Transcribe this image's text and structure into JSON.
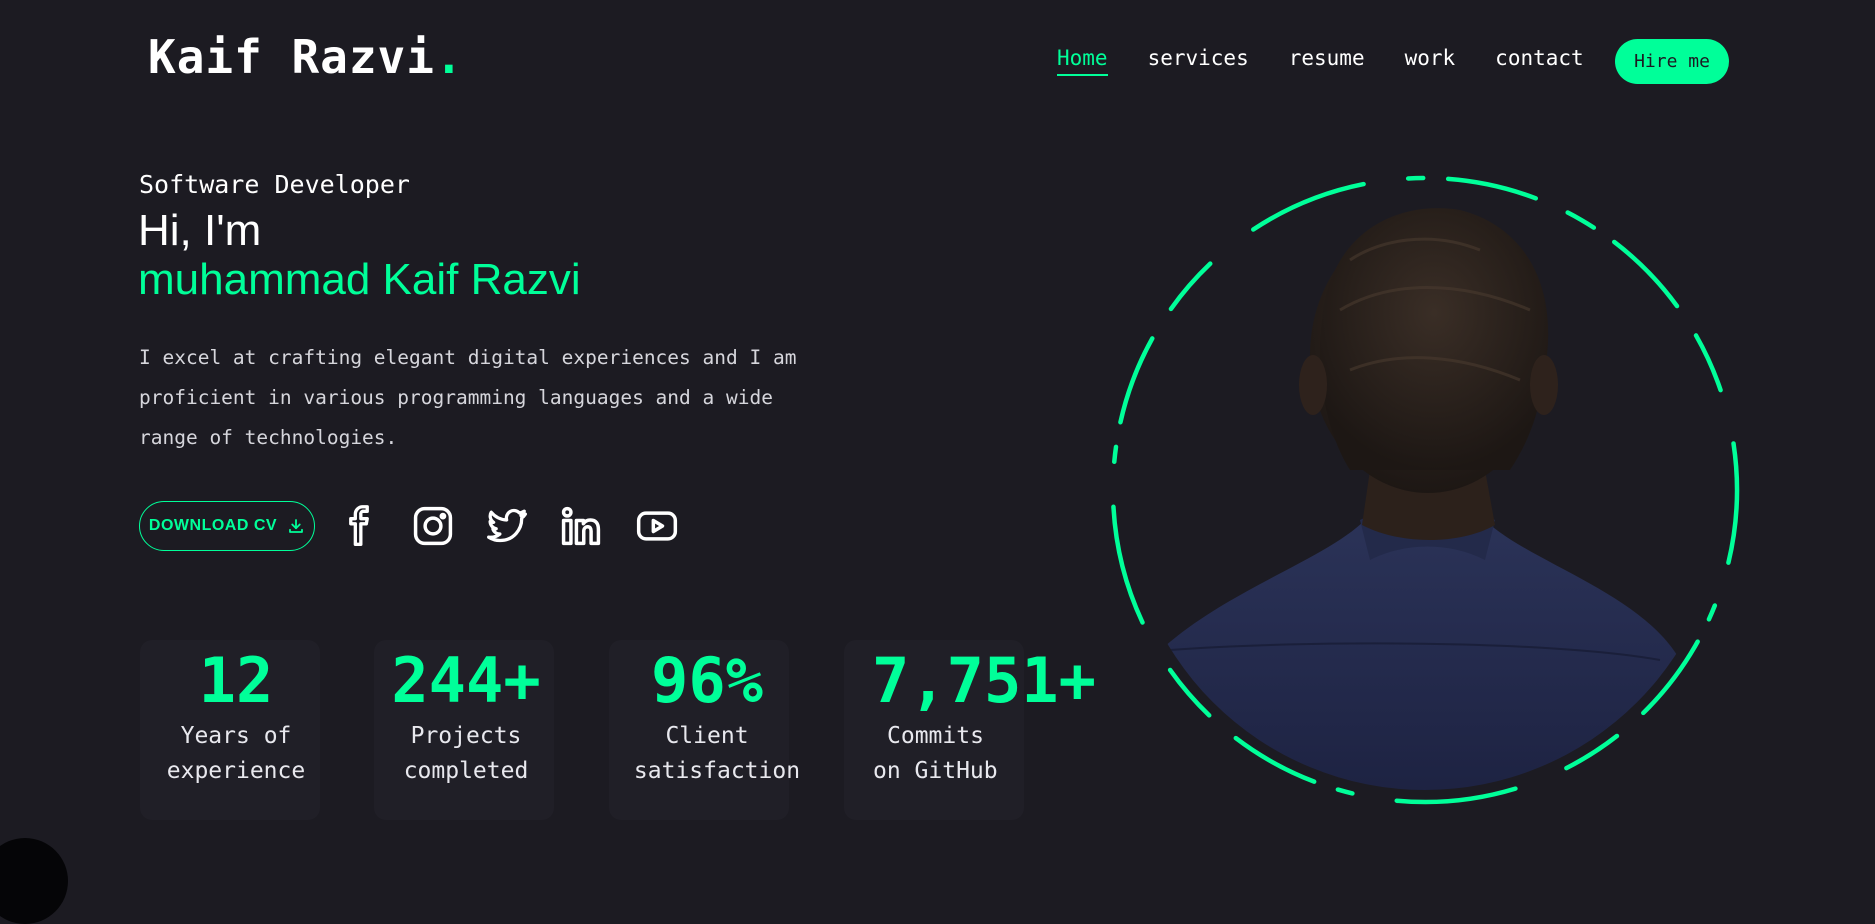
{
  "header": {
    "logo_text": "Kaif Razvi",
    "logo_dot": ".",
    "nav": [
      {
        "label": "Home",
        "active": true
      },
      {
        "label": "services",
        "active": false
      },
      {
        "label": "resume",
        "active": false
      },
      {
        "label": "work",
        "active": false
      },
      {
        "label": "contact",
        "active": false
      }
    ],
    "hire_label": "Hire me"
  },
  "hero": {
    "role": "Software Developer",
    "greeting": "Hi, I'm",
    "name": "muhammad Kaif Razvi",
    "description": "I excel at crafting elegant digital experiences and I am proficient in various programming languages and a wide range of technologies.",
    "download_label": "DOWNLOAD CV",
    "download_icon": "download-icon",
    "social_icons": [
      "facebook-icon",
      "instagram-icon",
      "twitter-icon",
      "linkedin-icon",
      "youtube-icon"
    ]
  },
  "stats": [
    {
      "value": "12",
      "label_line1": "Years of",
      "label_line2": "experience"
    },
    {
      "value": "244+",
      "label_line1": "Projects",
      "label_line2": "completed"
    },
    {
      "value": "96%",
      "label_line1": "Client",
      "label_line2": "satisfaction"
    },
    {
      "value": "7,751+",
      "label_line1": "Commits",
      "label_line2": "on GitHub"
    }
  ],
  "colors": {
    "background": "#1c1b22",
    "accent": "#00ff99",
    "text": "#ffffff"
  }
}
